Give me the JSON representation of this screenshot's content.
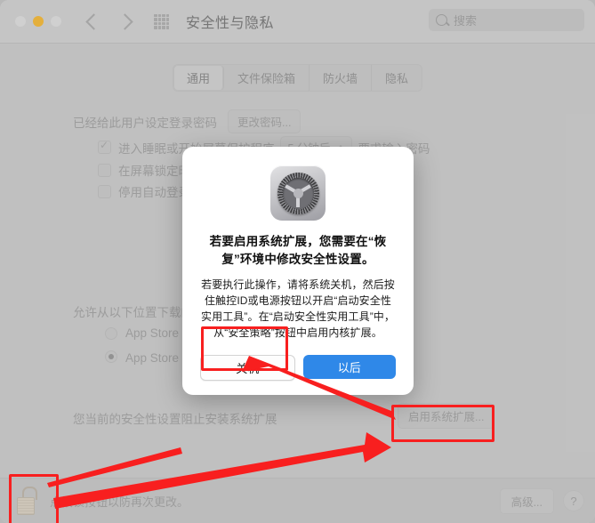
{
  "window": {
    "title": "安全性与隐私",
    "traffic_lights": [
      "close",
      "minimize",
      "zoom"
    ],
    "nav": {
      "back": "back-chevron",
      "forward": "forward-chevron",
      "grid": "show-all-grid"
    },
    "search": {
      "placeholder": "搜索",
      "value": ""
    }
  },
  "tabs": [
    {
      "label": "通用",
      "active": true
    },
    {
      "label": "文件保险箱",
      "active": false
    },
    {
      "label": "防火墙",
      "active": false
    },
    {
      "label": "隐私",
      "active": false
    }
  ],
  "general": {
    "password_set_label": "已经给此用户设定登录密码",
    "change_password_button": "更改密码...",
    "require_password_prefix": "进入睡眠或开始屏幕保护程序",
    "require_password_delay": "5 分钟后",
    "require_password_suffix": "要求输入密码",
    "screen_lock_message": "在屏幕锁定时显示信息",
    "disable_auto_login": "停用自动登录",
    "allow_apps_label": "允许从以下位置下载的应用:",
    "radio_app_store": "App Store",
    "radio_app_store_identified": "App Store 和被认可的开发者",
    "blocked_label": "您当前的安全性设置阻止安装系统扩展",
    "enable_extensions_button": "启用系统扩展..."
  },
  "bottom_bar": {
    "lock_hint": "点按锁按钮以防再次更改。",
    "lock_state": "unlocked",
    "advanced_button": "高级...",
    "help_button": "?"
  },
  "dialog": {
    "icon": "system-preferences-gear-icon",
    "title": "若要启用系统扩展，您需要在“恢复”环境中修改安全性设置。",
    "body": "若要执行此操作，请将系统关机，然后按住触控ID或电源按钮以开启“启动安全性实用工具”。在“启动安全性实用工具”中，从“安全策略”按钮中启用内核扩展。",
    "shutdown_button": "关机",
    "later_button": "以后"
  },
  "annotations": {
    "highlight_color": "#f81f1f",
    "boxes": [
      "shutdown-button",
      "enable-extensions-button",
      "lock-button"
    ],
    "arrows": [
      "enable-extensions-to-shutdown",
      "lock-to-enable-extensions"
    ]
  }
}
